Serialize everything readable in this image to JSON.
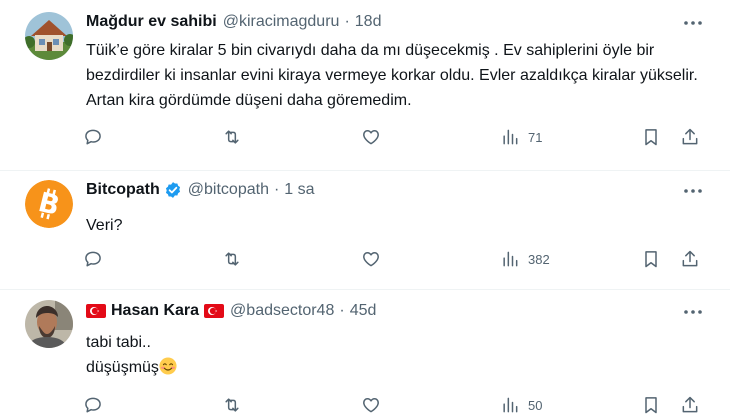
{
  "tweets": [
    {
      "name": "Mağdur ev sahibi",
      "handle": "@kiracimagduru",
      "dot": "·",
      "time": "18d",
      "text": "Tüik’e göre kiralar 5 bin civarıydı daha da mı düşecekmiş . Ev sahiplerini öyle bir bezdirdiler ki insanlar evini kiraya vermeye korkar oldu. Evler azaldıkça kiralar yükselir. Artan kira gördümde düşeni daha göremedim.",
      "views": "71"
    },
    {
      "name": "Bitcopath",
      "handle": "@bitcopath",
      "dot": "·",
      "time": "1 sa",
      "text": "Veri?",
      "views": "382"
    },
    {
      "name": "Hasan Kara",
      "handle": "@badsector48",
      "dot": "·",
      "time": "45d",
      "text_line1": "tabi tabi..",
      "text_line2": "düşüşmüş",
      "views": "50"
    }
  ],
  "colors": {
    "text": "#0f1419",
    "secondary": "#536471",
    "verified": "#1d9bf0",
    "bitcoin": "#f7931a",
    "turkey_red": "#e30a17"
  },
  "icons": [
    "reply-icon",
    "retweet-icon",
    "like-icon",
    "views-icon",
    "bookmark-icon",
    "share-icon",
    "more-icon",
    "verified-badge-icon",
    "turkey-flag-icon",
    "smiling-face-emoji"
  ]
}
